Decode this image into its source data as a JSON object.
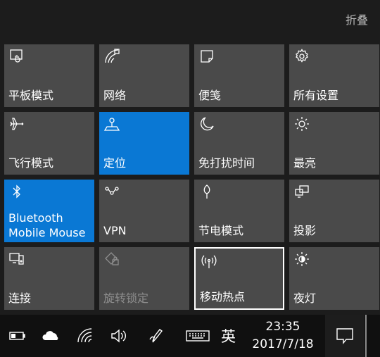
{
  "header": {
    "collapse_label": "折叠"
  },
  "tiles": [
    {
      "label": "平板模式",
      "icon": "tablet-mode-icon"
    },
    {
      "label": "网络",
      "icon": "network-icon"
    },
    {
      "label": "便笺",
      "icon": "note-icon"
    },
    {
      "label": "所有设置",
      "icon": "settings-gear-icon"
    },
    {
      "label": "飞行模式",
      "icon": "airplane-icon"
    },
    {
      "label": "定位",
      "icon": "location-icon",
      "state": "on"
    },
    {
      "label": "免打扰时间",
      "icon": "moon-icon"
    },
    {
      "label": "最亮",
      "icon": "brightness-icon"
    },
    {
      "label_line1": "Bluetooth",
      "label_line2": "Mobile Mouse",
      "icon": "bluetooth-icon",
      "state": "on"
    },
    {
      "label": "VPN",
      "icon": "vpn-icon"
    },
    {
      "label": "节电模式",
      "icon": "battery-saver-icon"
    },
    {
      "label": "投影",
      "icon": "project-icon"
    },
    {
      "label": "连接",
      "icon": "connect-icon"
    },
    {
      "label": "旋转锁定",
      "icon": "rotation-lock-icon",
      "state": "disabled"
    },
    {
      "label": "移动热点",
      "icon": "hotspot-icon",
      "state": "focused"
    },
    {
      "label": "夜灯",
      "icon": "night-light-icon"
    }
  ],
  "taskbar": {
    "ime_label": "英",
    "time": "23:35",
    "date": "2017/7/18",
    "icons": [
      "battery-icon",
      "onedrive-cloud-icon",
      "wifi-icon",
      "volume-icon",
      "pen-icon",
      "keyboard-icon",
      "action-center-icon"
    ]
  },
  "colors": {
    "tile": "#4a4a4a",
    "tile_on": "#0a78d4",
    "background": "#1c1c1c",
    "taskbar": "#101010"
  }
}
